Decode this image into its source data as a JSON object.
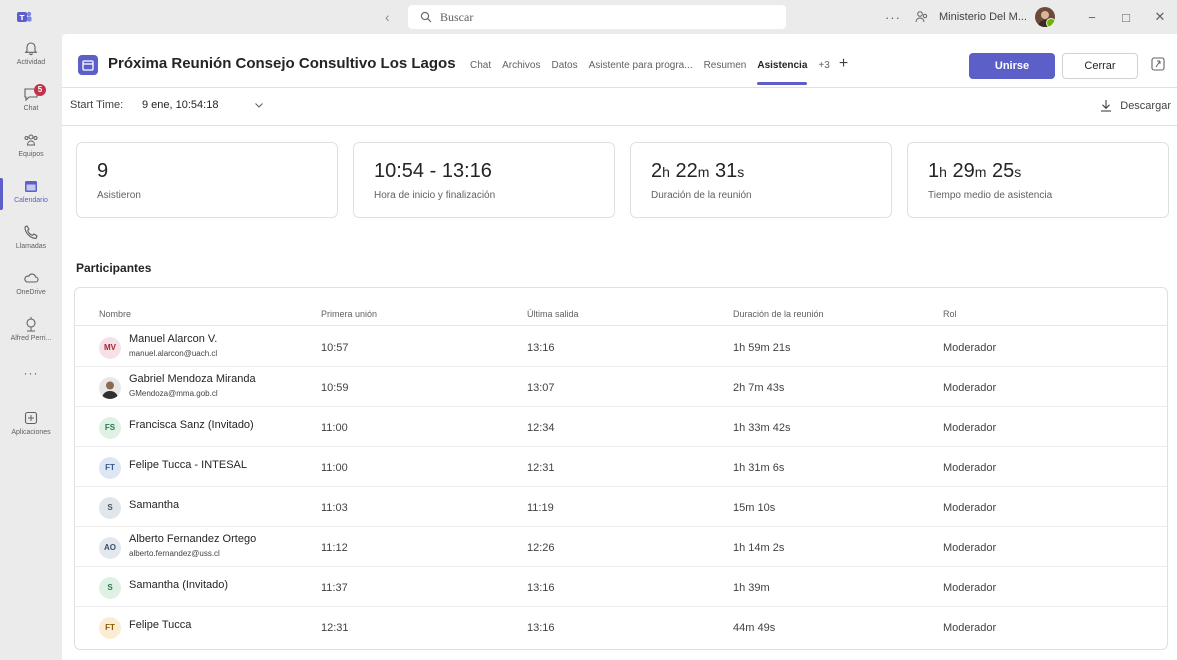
{
  "app": {
    "search_placeholder": "Buscar",
    "org_name": "Ministerio Del M...",
    "accent_color": "#5b5fc7"
  },
  "rail": {
    "items": [
      {
        "label": "Actividad",
        "icon": "bell-icon"
      },
      {
        "label": "Chat",
        "icon": "chat-icon",
        "badge": "5"
      },
      {
        "label": "Equipos",
        "icon": "teams-icon"
      },
      {
        "label": "Calendario",
        "icon": "calendar-icon",
        "active": true
      },
      {
        "label": "Llamadas",
        "icon": "phone-icon"
      },
      {
        "label": "OneDrive",
        "icon": "cloud-icon"
      },
      {
        "label": "Alfred Perri...",
        "icon": "app-icon"
      },
      {
        "label": "...",
        "icon": "more-icon"
      },
      {
        "label": "Aplicaciones",
        "icon": "add-apps-icon"
      }
    ]
  },
  "meeting": {
    "title": "Próxima Reunión Consejo Consultivo Los Lagos",
    "tabs": [
      "Chat",
      "Archivos",
      "Datos",
      "Asistente para progra...",
      "Resumen",
      "Asistencia",
      "+3"
    ],
    "active_tab": "Asistencia",
    "join_label": "Unirse",
    "close_label": "Cerrar"
  },
  "toolbar": {
    "start_time_label": "Start Time:",
    "start_time_value": "9 ene, 10:54:18",
    "download_label": "Descargar"
  },
  "summary": {
    "attended": {
      "value": "9",
      "label": "Asistieron"
    },
    "time_range": {
      "value": "10:54 - 13:16",
      "label": "Hora de inicio y finalización"
    },
    "duration": {
      "h": "2",
      "m": "22",
      "s": "31",
      "label": "Duración de la reunión"
    },
    "avg": {
      "h": "1",
      "m": "29",
      "s": "25",
      "label": "Tiempo medio de asistencia"
    },
    "unit_h": "h",
    "unit_m": "m",
    "unit_s": "s"
  },
  "participants": {
    "title": "Participantes",
    "columns": [
      "Nombre",
      "Primera unión",
      "Última salida",
      "Duración de la reunión",
      "Rol"
    ],
    "rows": [
      {
        "initials": "MV",
        "name": "Manuel Alarcon V.",
        "email": "manuel.alarcon@uach.cl",
        "first_join": "10:57",
        "last_leave": "13:16",
        "duration": "1h 59m 21s",
        "role": "Moderador",
        "avatar_bg": "#f7e1e8",
        "avatar_fg": "#a4262c"
      },
      {
        "initials": "",
        "name": "Gabriel Mendoza Miranda",
        "email": "GMendoza@mma.gob.cl",
        "first_join": "10:59",
        "last_leave": "13:07",
        "duration": "2h 7m 43s",
        "role": "Moderador",
        "avatar_bg": "#3b3b3b",
        "avatar_fg": "#ffffff"
      },
      {
        "initials": "FS",
        "name": "Francisca Sanz (Invitado)",
        "email": "",
        "first_join": "11:00",
        "last_leave": "12:34",
        "duration": "1h 33m 42s",
        "role": "Moderador",
        "avatar_bg": "#dff0e4",
        "avatar_fg": "#237b4b"
      },
      {
        "initials": "FT",
        "name": "Felipe Tucca - INTESAL",
        "email": "",
        "first_join": "11:00",
        "last_leave": "12:31",
        "duration": "1h 31m 6s",
        "role": "Moderador",
        "avatar_bg": "#dde6f3",
        "avatar_fg": "#3a5a8c"
      },
      {
        "initials": "S",
        "name": "Samantha",
        "email": "",
        "first_join": "11:03",
        "last_leave": "11:19",
        "duration": "15m 10s",
        "role": "Moderador",
        "avatar_bg": "#e1e6ea",
        "avatar_fg": "#4a5560"
      },
      {
        "initials": "AO",
        "name": "Alberto Fernandez Ortego",
        "email": "alberto.fernandez@uss.cl",
        "first_join": "11:12",
        "last_leave": "12:26",
        "duration": "1h 14m 2s",
        "role": "Moderador",
        "avatar_bg": "#e3e8ee",
        "avatar_fg": "#3d4f66"
      },
      {
        "initials": "S",
        "name": "Samantha (Invitado)",
        "email": "",
        "first_join": "11:37",
        "last_leave": "13:16",
        "duration": "1h 39m",
        "role": "Moderador",
        "avatar_bg": "#dff0e4",
        "avatar_fg": "#237b4b"
      },
      {
        "initials": "FT",
        "name": "Felipe Tucca",
        "email": "",
        "first_join": "12:31",
        "last_leave": "13:16",
        "duration": "44m 49s",
        "role": "Moderador",
        "avatar_bg": "#fbedd3",
        "avatar_fg": "#8a5a00"
      }
    ]
  }
}
